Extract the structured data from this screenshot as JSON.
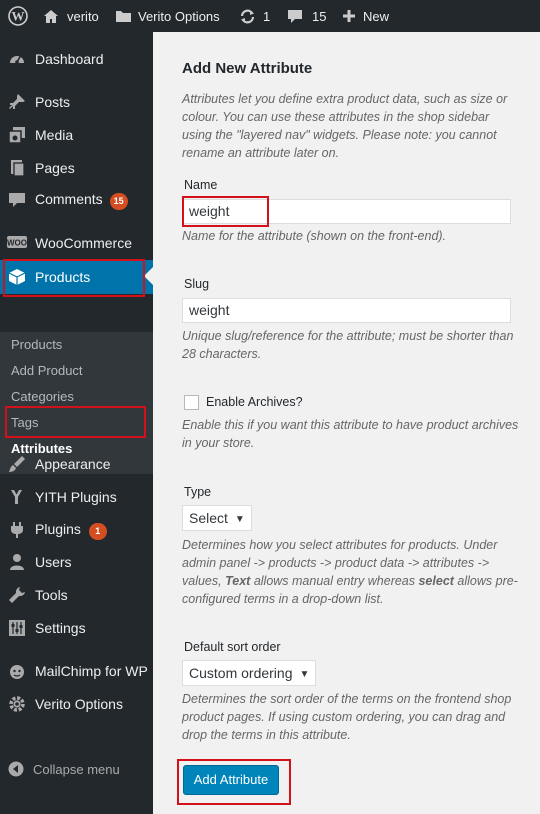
{
  "admin_bar": {
    "site_name": "verito",
    "options_label": "Verito Options",
    "updates_count": "1",
    "comments_count": "15",
    "new_label": "New"
  },
  "sidebar": {
    "dashboard": "Dashboard",
    "posts": "Posts",
    "media": "Media",
    "pages": "Pages",
    "comments": "Comments",
    "comments_badge": "15",
    "woocommerce": "WooCommerce",
    "products": "Products",
    "submenu": {
      "products": "Products",
      "add_product": "Add Product",
      "categories": "Categories",
      "tags": "Tags",
      "attributes": "Attributes"
    },
    "appearance": "Appearance",
    "yith_plugins": "YITH Plugins",
    "plugins": "Plugins",
    "plugins_badge": "1",
    "users": "Users",
    "tools": "Tools",
    "settings": "Settings",
    "mailchimp": "MailChimp for WP",
    "verito_options": "Verito Options",
    "collapse": "Collapse menu",
    "accent_color": "#0073aa"
  },
  "form": {
    "heading": "Add New Attribute",
    "intro": "Attributes let you define extra product data, such as size or colour. You can use these attributes in the shop sidebar using the \"layered nav\" widgets. Please note: you cannot rename an attribute later on.",
    "name_label": "Name",
    "name_value": "weight",
    "name_desc": "Name for the attribute (shown on the front-end).",
    "slug_label": "Slug",
    "slug_value": "weight",
    "slug_desc": "Unique slug/reference for the attribute; must be shorter than 28 characters.",
    "archives_label": "Enable Archives?",
    "archives_desc": "Enable this if you want this attribute to have product archives in your store.",
    "type_label": "Type",
    "type_value": "Select",
    "type_desc_1": "Determines how you select attributes for products. Under admin panel -> products -> product data -> attributes -> values, ",
    "type_desc_text": "Text",
    "type_desc_2": " allows manual entry whereas ",
    "type_desc_select": "select",
    "type_desc_3": " allows pre-configured terms in a drop-down list.",
    "sort_label": "Default sort order",
    "sort_value": "Custom ordering",
    "sort_desc": "Determines the sort order of the terms on the frontend shop product pages. If using custom ordering, you can drag and drop the terms in this attribute.",
    "submit_label": "Add Attribute"
  }
}
